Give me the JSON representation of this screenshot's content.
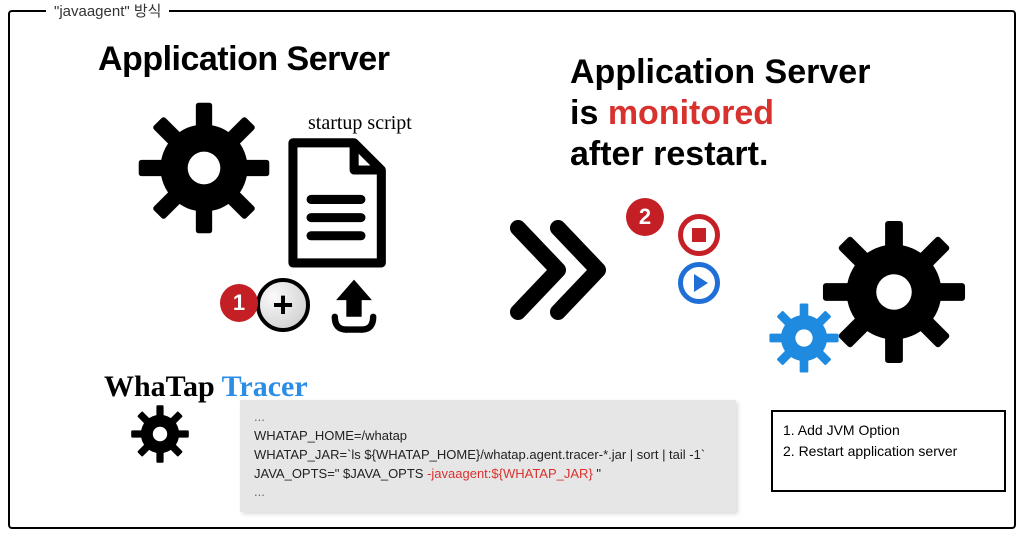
{
  "frame": {
    "title": "\"javaagent\" 방식"
  },
  "left": {
    "title": "Application Server",
    "startup_label": "startup script",
    "whatap": "WhaTap",
    "tracer": "Tracer"
  },
  "right": {
    "title_line1": "Application Server",
    "title_line2a": "is ",
    "title_line2b": "monitored",
    "title_line3": "after restart."
  },
  "badges": {
    "one": "1",
    "two": "2"
  },
  "code": {
    "ellipsis1": "...",
    "line1": "WHATAP_HOME=/whatap",
    "line2": "WHATAP_JAR=`ls ${WHATAP_HOME}/whatap.agent.tracer-*.jar | sort | tail -1`",
    "line3a": "JAVA_OPTS=\" $JAVA_OPTS ",
    "line3b": "-javaagent:${WHATAP_JAR}",
    "line3c": " \"",
    "ellipsis2": "..."
  },
  "legend": {
    "item1": "1. Add JVM Option",
    "item2": "2. Restart application server"
  },
  "plus_glyph": "+"
}
